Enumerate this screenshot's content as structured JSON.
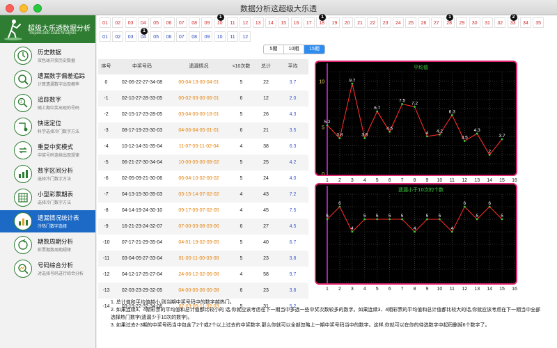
{
  "window": {
    "title": "数据分析这超级大乐透"
  },
  "brand": {
    "title": "超级大乐透数据分析",
    "subtitle": "SuperLotto Data Analysis"
  },
  "sidebar": {
    "items": [
      {
        "title": "历史数据",
        "subtitle": "双色球开奖历史数据",
        "icon": "clock-icon",
        "active": false
      },
      {
        "title": "遗漏数字偏差追踪",
        "subtitle": "计算遗漏数字出现概率",
        "icon": "magnifier-icon",
        "active": false
      },
      {
        "title": "追踪数字",
        "subtitle": "随上期中奖出现的号码",
        "icon": "trace-icon",
        "active": false
      },
      {
        "title": "快速定位",
        "subtitle": "科学选择冷门数字方法",
        "icon": "locate-icon",
        "active": false
      },
      {
        "title": "重复中奖模式",
        "subtitle": "中奖号码连续出现规律",
        "icon": "repeat-icon",
        "active": false
      },
      {
        "title": "数字区间分析",
        "subtitle": "选择冷门数字方法",
        "icon": "interval-icon",
        "active": false
      },
      {
        "title": "小型彩票期表",
        "subtitle": "选择冷门数字方法",
        "icon": "table-icon",
        "active": false
      },
      {
        "title": "遗漏情况统计表",
        "subtitle": "冷热门数字选择",
        "icon": "stats-icon",
        "active": true
      },
      {
        "title": "期数周期分析",
        "subtitle": "彩票期数周期规律",
        "icon": "cycle-icon",
        "active": false
      },
      {
        "title": "号码综合分析",
        "subtitle": "对选择号码进行综合分析",
        "icon": "search-chart-icon",
        "active": false
      }
    ]
  },
  "red_numbers": [
    "01",
    "02",
    "03",
    "04",
    "05",
    "06",
    "07",
    "08",
    "09",
    "10",
    "11",
    "12",
    "13",
    "14",
    "15",
    "16",
    "17",
    "18",
    "19",
    "20",
    "21",
    "22",
    "23",
    "24",
    "25",
    "26",
    "27",
    "28",
    "29",
    "30",
    "31",
    "32",
    "33",
    "34",
    "35"
  ],
  "red_badges": {
    "10": "1",
    "18": "1",
    "28": "1",
    "33": "2"
  },
  "blue_numbers": [
    "01",
    "02",
    "03",
    "04",
    "05",
    "06",
    "07",
    "08",
    "09",
    "10",
    "11",
    "12"
  ],
  "blue_badges": {
    "04": "1"
  },
  "tabs": [
    {
      "label": "5期",
      "active": false
    },
    {
      "label": "10期",
      "active": false
    },
    {
      "label": "15期",
      "active": true
    }
  ],
  "table": {
    "headers": [
      "序号",
      "中奖号码",
      "遗漏情况",
      "<10次数",
      "总计",
      "平均"
    ],
    "rows": [
      [
        "0",
        "02-06-22-27-34-08",
        "00-04-13-00-04-01",
        "5",
        "22",
        "3.7"
      ],
      [
        "-1",
        "02-10-27-28-33-05",
        "00-02-03-00-06-01",
        "6",
        "12",
        "2.0"
      ],
      [
        "-2",
        "02-15-17-23-28-05",
        "03-04-00-00-18-01",
        "5",
        "26",
        "4.3"
      ],
      [
        "-3",
        "08-17-19-23-30-03",
        "04-06-04-05-01-01",
        "6",
        "21",
        "3.5"
      ],
      [
        "-4",
        "10-12-14-31-35-04",
        "11-07-03-11-02-04",
        "4",
        "38",
        "6.3"
      ],
      [
        "-5",
        "06-21-27-30-34-04",
        "10-00-05-00-08-02",
        "5",
        "25",
        "4.2"
      ],
      [
        "-6",
        "02-05-09-21-30-06",
        "06-04-10-02-00-02",
        "5",
        "24",
        "4.0"
      ],
      [
        "-7",
        "04-13-15-30-35-03",
        "03-15-14-07-02-02",
        "4",
        "43",
        "7.2"
      ],
      [
        "-8",
        "04-14-19-24-30-10",
        "09-17-05-07-02-05",
        "4",
        "45",
        "7.5"
      ],
      [
        "-9",
        "16-21-23-24-32-07",
        "07-00-03-08-03-06",
        "6",
        "27",
        "4.5"
      ],
      [
        "-10",
        "07-17-21-29-35-04",
        "04-01-19-02-09-05",
        "5",
        "40",
        "6.7"
      ],
      [
        "-11",
        "03-04-05-27-33-04",
        "01-00-11-00-03-08",
        "5",
        "23",
        "3.8"
      ],
      [
        "-12",
        "04-12-17-25-27-04",
        "24-06-12-02-06-08",
        "4",
        "58",
        "9.7"
      ],
      [
        "-13",
        "02-03-23-29-32-05",
        "04-00-05-06-00-08",
        "6",
        "23",
        "3.8"
      ],
      [
        "-14",
        "03-19-22-32-34-08",
        "07-03-05-11-02-03",
        "5",
        "31",
        "5.2"
      ]
    ]
  },
  "chart_data": [
    {
      "type": "line",
      "title": "平均值",
      "x": [
        1,
        2,
        3,
        4,
        5,
        6,
        7,
        8,
        9,
        10,
        11,
        12,
        13,
        14,
        15
      ],
      "values": [
        5.2,
        3.8,
        9.7,
        3.8,
        6.7,
        4.5,
        7.5,
        7.2,
        4.0,
        4.2,
        6.3,
        3.5,
        4.3,
        2.0,
        3.7
      ],
      "xlim": [
        1,
        16
      ],
      "ylim": [
        0,
        11
      ],
      "yticks": [
        0,
        5,
        10
      ],
      "xticks": [
        1,
        2,
        3,
        4,
        5,
        6,
        7,
        8,
        9,
        10,
        11,
        12,
        13,
        14,
        15,
        16
      ],
      "grid": true,
      "colors": {
        "line": "#ff2a2a",
        "point": "#ffffff",
        "title": "#39d03a",
        "axis": "#d02fd6",
        "label": "#ffe16a",
        "grid": "#5a5a5a"
      }
    },
    {
      "type": "line",
      "title": "遗漏小于10次的个数",
      "x": [
        1,
        2,
        3,
        4,
        5,
        6,
        7,
        8,
        9,
        10,
        11,
        12,
        13,
        14,
        15
      ],
      "values": [
        5,
        6,
        4,
        5,
        5,
        5,
        5,
        4,
        5,
        5,
        4,
        6,
        5,
        6,
        5
      ],
      "xlim": [
        1,
        16
      ],
      "ylim": [
        0,
        7
      ],
      "yticks": [],
      "xticks": [
        1,
        2,
        3,
        4,
        5,
        6,
        7,
        8,
        9,
        10,
        11,
        12,
        13,
        14,
        15,
        16
      ],
      "grid": true,
      "colors": {
        "line": "#ff2a2a",
        "point": "#ffffff",
        "title": "#39d03a",
        "axis": "#d02fd6",
        "label": "#ffe16a",
        "grid": "#5a5a5a"
      }
    }
  ],
  "notes": [
    "1. 总计值和平均值越小,则当期中奖号码中的数字越热门。",
    "2. 如果连续3、4期彩票的平均值和总计值都比较小的 话,你就应该考虑在下一期当中多选一些中奖次数较多的数字。如果连续3、4期彩票的平均值和总计值都比较大的话,你就应该考虑在下一期当中全部选择热门数字(遗漏少于10次的数字)。",
    "3. 如果过去2-3期的中奖号码当中包含了2个或2个以上过去的中奖数字,那么你就可以全部忽略上一期中奖号码当中的数字。这样,你就可以在你的待选数字中起码删掉6个数字了。"
  ]
}
